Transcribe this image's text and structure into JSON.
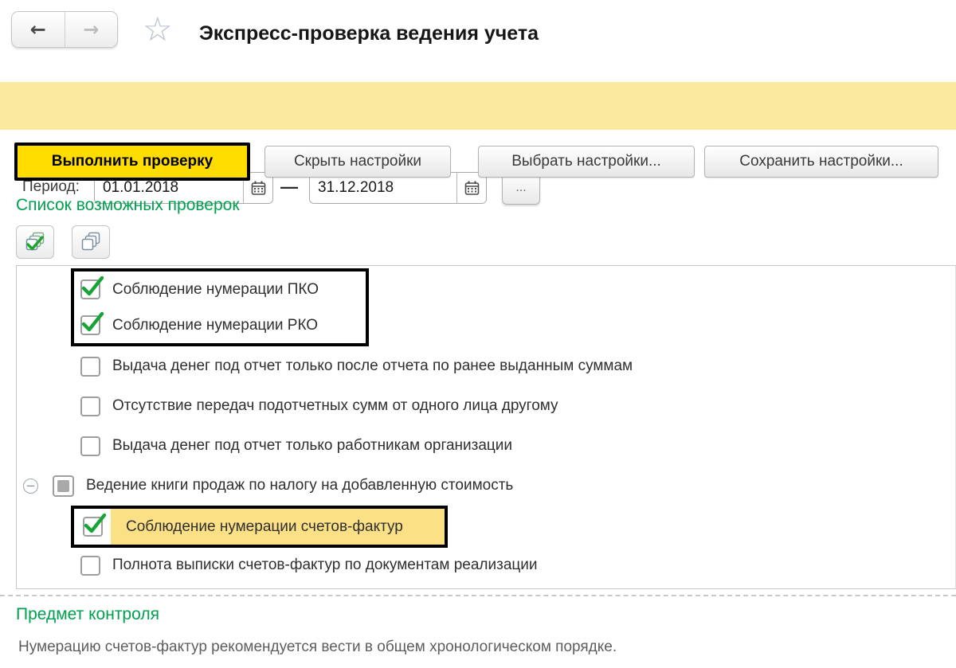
{
  "header": {
    "back_icon": "←",
    "forward_icon": "→",
    "star_icon": "☆",
    "title": "Экспресс-проверка ведения учета"
  },
  "period": {
    "label": "Период:",
    "from_value": "01.01.2018",
    "to_value": "31.12.2018",
    "dash": "—",
    "more_label": "...",
    "calendar_icon": "calendar-icon"
  },
  "actions": {
    "run": "Выполнить проверку",
    "hide": "Скрыть настройки",
    "choose": "Выбрать настройки...",
    "save": "Сохранить настройки..."
  },
  "checks": {
    "title": "Список возможных проверок",
    "toolbar": {
      "check_all_icon": "stacked-pages-with-check",
      "uncheck_all_icon": "stacked-pages"
    },
    "items": [
      {
        "label": "Соблюдение нумерации ПКО",
        "checked": true
      },
      {
        "label": "Соблюдение нумерации РКО",
        "checked": true
      },
      {
        "label": "Выдача денег под отчет только после отчета по ранее выданным суммам",
        "checked": false
      },
      {
        "label": "Отсутствие передач подотчетных сумм от одного лица другому",
        "checked": false
      },
      {
        "label": "Выдача денег под отчет только работникам организации",
        "checked": false
      },
      {
        "label": "Ведение книги продаж по налогу на добавленную стоимость",
        "state": "partial",
        "expander": "−"
      },
      {
        "label": "Соблюдение нумерации счетов-фактур",
        "checked": true,
        "selected": true
      },
      {
        "label": "Полнота выписки счетов-фактур по документам реализации",
        "checked": false
      }
    ]
  },
  "subject": {
    "title": "Предмет контроля",
    "text": "Нумерацию счетов-фактур рекомендуется вести в общем хронологическом порядке."
  },
  "colors": {
    "bar_yellow": "#fbe9a0",
    "button_yellow": "#ffdd00",
    "selection_yellow": "#fbe086",
    "heading_green": "#00a04e",
    "check_green": "#17a436"
  }
}
